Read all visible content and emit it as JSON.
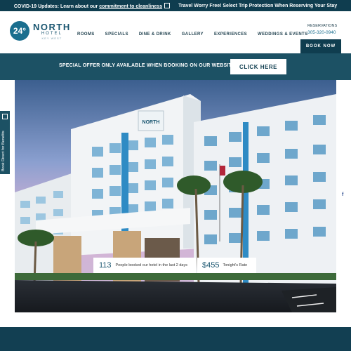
{
  "topbar": {
    "covid_prefix": "COVID-19 Updates: Learn about our",
    "covid_link": "commitment to cleanliness",
    "travel_text": "Travel Worry Free! Select Trip Protection When Reserving Your Stay"
  },
  "logo": {
    "badge": "24°",
    "name": "NORTH",
    "subtitle": "HOTEL",
    "location": "KEY WEST"
  },
  "nav": {
    "items": [
      "ROOMS",
      "SPECIALS",
      "DINE & DRINK",
      "GALLERY",
      "EXPERIENCES",
      "WEDDINGS & EVENTS"
    ]
  },
  "reservations": {
    "label": "RESERVATIONS",
    "phone": "305-320-0940"
  },
  "book_button": "BOOK NOW",
  "offer": {
    "text": "SPECIAL OFFER ONLY AVAILABLE WHEN BOOKING ON OUR WEBSITE!",
    "button": "CLICK HERE"
  },
  "side_tab": {
    "label": "Book Direct for Benefits"
  },
  "social": {
    "facebook": "f"
  },
  "stats": {
    "booked_count": "113",
    "booked_label": "People booked our hotel in the last 2 days",
    "rate": "$455",
    "rate_label": "Tonight's Rate"
  },
  "hero": {
    "sign": "NORTH"
  },
  "colors": {
    "brand_dark": "#0f3d4f",
    "brand_teal": "#1c5164",
    "accent": "#1a6e8e"
  }
}
